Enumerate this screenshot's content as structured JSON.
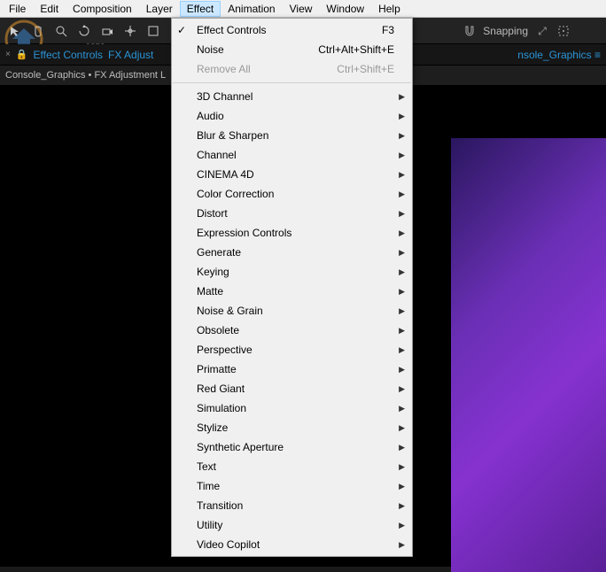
{
  "menubar": [
    "File",
    "Edit",
    "Composition",
    "Layer",
    "Effect",
    "Animation",
    "View",
    "Window",
    "Help"
  ],
  "active_menu_index": 4,
  "watermark_url": "www.pc0359.cn",
  "snapping_label": "Snapping",
  "tabbar": {
    "effect_controls": "Effect Controls",
    "fx_adjust": "FX Adjust",
    "right_tab": "nsole_Graphics"
  },
  "subheader": "Console_Graphics • FX Adjustment L",
  "menu_top": [
    {
      "label": "Effect Controls",
      "shortcut": "F3",
      "checked": true,
      "disabled": false
    },
    {
      "label": "Noise",
      "shortcut": "Ctrl+Alt+Shift+E",
      "checked": false,
      "disabled": false
    },
    {
      "label": "Remove All",
      "shortcut": "Ctrl+Shift+E",
      "checked": false,
      "disabled": true
    }
  ],
  "menu_categories": [
    "3D Channel",
    "Audio",
    "Blur & Sharpen",
    "Channel",
    "CINEMA 4D",
    "Color Correction",
    "Distort",
    "Expression Controls",
    "Generate",
    "Keying",
    "Matte",
    "Noise & Grain",
    "Obsolete",
    "Perspective",
    "Primatte",
    "Red Giant",
    "Simulation",
    "Stylize",
    "Synthetic Aperture",
    "Text",
    "Time",
    "Transition",
    "Utility",
    "Video Copilot"
  ]
}
